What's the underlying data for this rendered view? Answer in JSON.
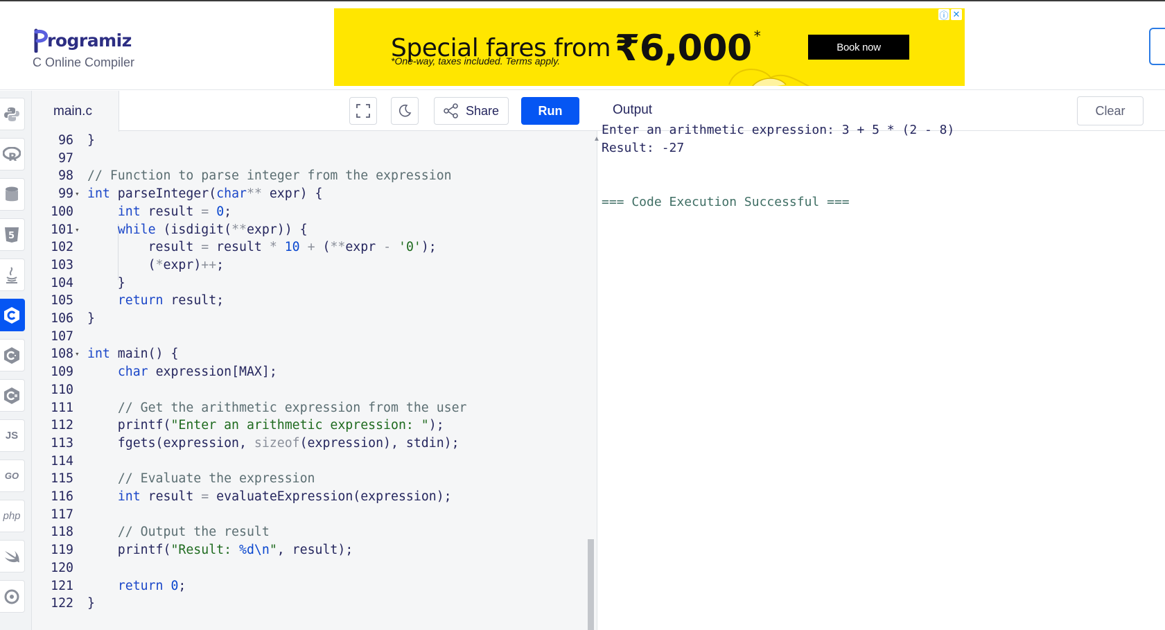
{
  "header": {
    "brand": "rogramiz",
    "subtitle": "C Online Compiler"
  },
  "ad": {
    "headline": "Special fares from",
    "price": "₹6,000",
    "star": "*",
    "fine_print": "*One-way, taxes included. Terms apply.",
    "button": "Book now"
  },
  "sidebar": {
    "languages": [
      {
        "name": "python-icon"
      },
      {
        "name": "r-icon"
      },
      {
        "name": "sql-icon"
      },
      {
        "name": "html5-icon"
      },
      {
        "name": "java-icon"
      },
      {
        "name": "c-icon",
        "active": true
      },
      {
        "name": "cpp-icon"
      },
      {
        "name": "csharp-icon"
      },
      {
        "name": "js-icon",
        "label": "JS"
      },
      {
        "name": "go-icon",
        "label": "GO"
      },
      {
        "name": "php-icon",
        "label": "php"
      },
      {
        "name": "swift-icon"
      },
      {
        "name": "rust-icon"
      }
    ]
  },
  "editor": {
    "filename": "main.c",
    "share_label": "Share",
    "run_label": "Run",
    "lines": [
      {
        "n": "96",
        "code": "}"
      },
      {
        "n": "97",
        "code": ""
      },
      {
        "n": "98",
        "code": "// Function to parse integer from the expression"
      },
      {
        "n": "99",
        "code": "int parseInteger(char** expr) {",
        "fold": true
      },
      {
        "n": "100",
        "code": "    int result = 0;"
      },
      {
        "n": "101",
        "code": "    while (isdigit(**expr)) {",
        "fold": true
      },
      {
        "n": "102",
        "code": "        result = result * 10 + (**expr - '0');"
      },
      {
        "n": "103",
        "code": "        (*expr)++;"
      },
      {
        "n": "104",
        "code": "    }"
      },
      {
        "n": "105",
        "code": "    return result;"
      },
      {
        "n": "106",
        "code": "}"
      },
      {
        "n": "107",
        "code": ""
      },
      {
        "n": "108",
        "code": "int main() {",
        "fold": true
      },
      {
        "n": "109",
        "code": "    char expression[MAX];"
      },
      {
        "n": "110",
        "code": ""
      },
      {
        "n": "111",
        "code": "    // Get the arithmetic expression from the user"
      },
      {
        "n": "112",
        "code": "    printf(\"Enter an arithmetic expression: \");"
      },
      {
        "n": "113",
        "code": "    fgets(expression, sizeof(expression), stdin);"
      },
      {
        "n": "114",
        "code": ""
      },
      {
        "n": "115",
        "code": "    // Evaluate the expression"
      },
      {
        "n": "116",
        "code": "    int result = evaluateExpression(expression);"
      },
      {
        "n": "117",
        "code": ""
      },
      {
        "n": "118",
        "code": "    // Output the result"
      },
      {
        "n": "119",
        "code": "    printf(\"Result: %d\\n\", result);"
      },
      {
        "n": "120",
        "code": ""
      },
      {
        "n": "121",
        "code": "    return 0;"
      },
      {
        "n": "122",
        "code": "}"
      }
    ]
  },
  "output": {
    "title": "Output",
    "clear_label": "Clear",
    "lines": [
      "Enter an arithmetic expression: 3 + 5 * (2 - 8)",
      "Result: -27",
      "",
      "",
      "=== Code Execution Successful ==="
    ]
  }
}
